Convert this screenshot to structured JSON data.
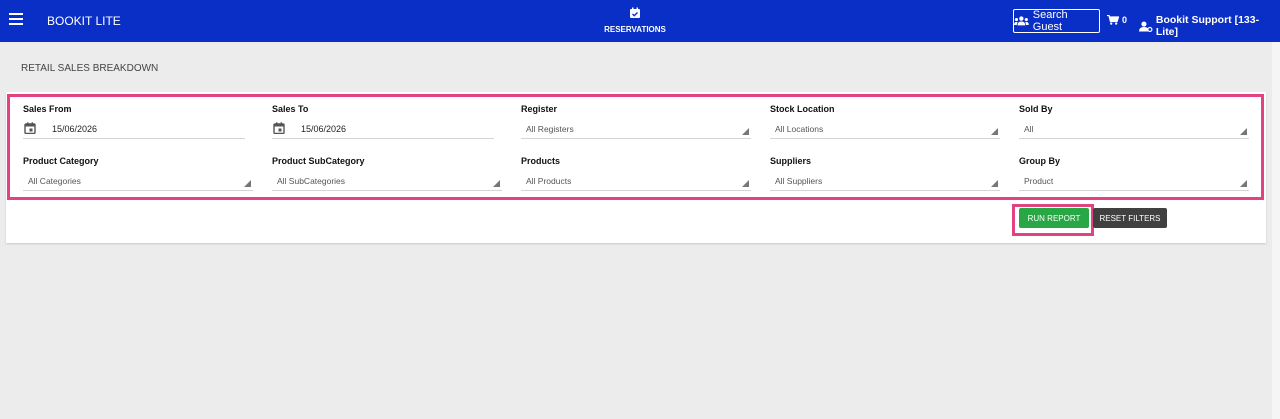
{
  "header": {
    "app_title": "BOOKIT LITE",
    "center_label": "RESERVATIONS",
    "search_guest_label": "Search Guest",
    "cart_count": "0",
    "user_label": "Bookit Support [133-Lite]"
  },
  "page": {
    "title": "RETAIL SALES BREAKDOWN"
  },
  "filters": {
    "sales_from": {
      "label": "Sales From",
      "value": "15/06/2026"
    },
    "sales_to": {
      "label": "Sales To",
      "value": "15/06/2026"
    },
    "register": {
      "label": "Register",
      "value": "All Registers"
    },
    "stock_location": {
      "label": "Stock Location",
      "value": "All Locations"
    },
    "sold_by": {
      "label": "Sold By",
      "value": "All"
    },
    "product_category": {
      "label": "Product Category",
      "value": "All Categories"
    },
    "product_subcategory": {
      "label": "Product SubCategory",
      "value": "All SubCategories"
    },
    "products": {
      "label": "Products",
      "value": "All Products"
    },
    "suppliers": {
      "label": "Suppliers",
      "value": "All Suppliers"
    },
    "group_by": {
      "label": "Group By",
      "value": "Product"
    }
  },
  "actions": {
    "run_report": "RUN REPORT",
    "reset_filters": "RESET FILTERS"
  },
  "colors": {
    "header_bg": "#0a2fc6",
    "highlight": "#e2427f",
    "run_button": "#28a745",
    "reset_button": "#404040"
  },
  "icons": [
    "menu-icon",
    "calendar-check-icon",
    "users-icon",
    "cart-icon",
    "user-cog-icon",
    "calendar-icon",
    "dropdown-caret-icon"
  ]
}
